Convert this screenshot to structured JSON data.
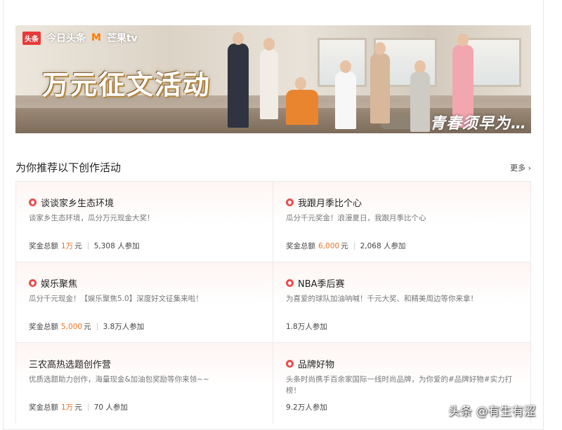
{
  "banner": {
    "logo_toutiao_badge": "头条",
    "logo_toutiao_text": "今日头条",
    "logo_mango_mark": "M",
    "logo_mango_text": "芒果tv",
    "title": "万元征文活动",
    "show_title": "青春须早为…"
  },
  "section": {
    "title": "为你推荐以下创作活动",
    "more_label": "更多",
    "more_icon": "chevron-right-icon"
  },
  "activities": [
    {
      "title": "谈谈家乡生态环境",
      "hot": true,
      "desc": "谈家乡生态环境，瓜分万元现金大奖！",
      "prize_label": "奖金总额",
      "prize_value": "1万",
      "prize_unit": "元",
      "participants": "5,308 人参加"
    },
    {
      "title": "我跟月季比个心",
      "hot": true,
      "desc": "瓜分千元奖金！浪漫夏日，我跟月季比个心",
      "prize_label": "奖金总额",
      "prize_value": "6,000",
      "prize_unit": "元",
      "participants": "2,068 人参加"
    },
    {
      "title": "娱乐聚焦",
      "hot": true,
      "desc": "瓜分千元现金！【娱乐聚焦5.0】深度好文征集来啦！",
      "prize_label": "奖金总额",
      "prize_value": "5,000",
      "prize_unit": "元",
      "participants": "3.8万人参加"
    },
    {
      "title": "NBA季后赛",
      "hot": true,
      "desc": "为喜爱的球队加油呐喊！千元大奖、和精美周边等你来拿！",
      "prize_label": "",
      "prize_value": "",
      "prize_unit": "",
      "participants": "1.8万人参加"
    },
    {
      "title": "三农高热选题创作营",
      "hot": false,
      "desc": "优质选题助力创作，海量现金&加油包奖励等你来领~~",
      "prize_label": "奖金总额",
      "prize_value": "1万",
      "prize_unit": "元",
      "participants": "70 人参加"
    },
    {
      "title": "品牌好物",
      "hot": true,
      "desc": "头条时尚携手百余家国际一线时尚品牌，为你爱的#品牌好物#实力打榜！",
      "prize_label": "",
      "prize_value": "",
      "prize_unit": "",
      "participants": "9.2万人参加"
    }
  ],
  "colors": {
    "accent": "#f07122",
    "hot_icon": "#ef4a4a"
  },
  "watermark": "头条 @有生有涩"
}
